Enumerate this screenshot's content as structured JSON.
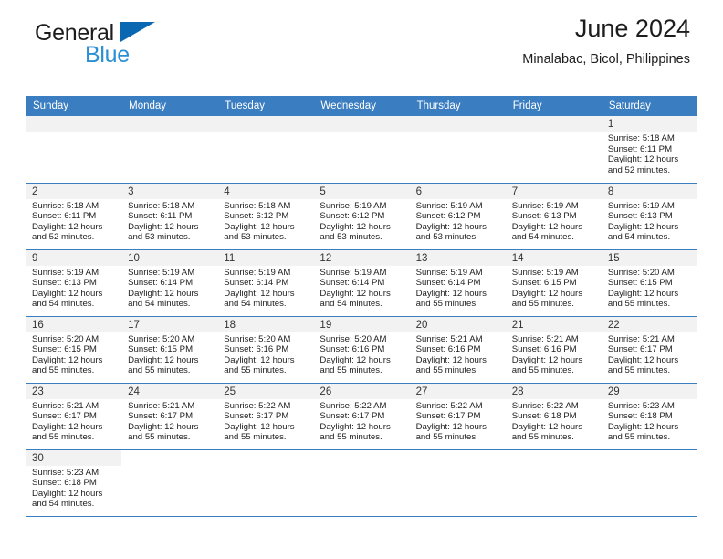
{
  "brand": {
    "name_part1": "General",
    "name_part2": "Blue",
    "flag_icon": "blue-triangle-flag"
  },
  "header": {
    "title": "June 2024",
    "location": "Minalabac, Bicol, Philippines"
  },
  "colors": {
    "header_blue": "#3a7dc0",
    "logo_dark": "#1d1d1d",
    "logo_blue": "#2a8fd4",
    "daynum_bg": "#f2f2f2"
  },
  "calendar": {
    "weekday_headers": [
      "Sunday",
      "Monday",
      "Tuesday",
      "Wednesday",
      "Thursday",
      "Friday",
      "Saturday"
    ],
    "labels": {
      "sunrise": "Sunrise:",
      "sunset": "Sunset:",
      "daylight": "Daylight:"
    },
    "weeks": [
      [
        {
          "empty": true
        },
        {
          "empty": true
        },
        {
          "empty": true
        },
        {
          "empty": true
        },
        {
          "empty": true
        },
        {
          "empty": true
        },
        {
          "day": "1",
          "sunrise": "Sunrise: 5:18 AM",
          "sunset": "Sunset: 6:11 PM",
          "daylight_line1": "Daylight: 12 hours",
          "daylight_line2": "and 52 minutes."
        }
      ],
      [
        {
          "day": "2",
          "sunrise": "Sunrise: 5:18 AM",
          "sunset": "Sunset: 6:11 PM",
          "daylight_line1": "Daylight: 12 hours",
          "daylight_line2": "and 52 minutes."
        },
        {
          "day": "3",
          "sunrise": "Sunrise: 5:18 AM",
          "sunset": "Sunset: 6:11 PM",
          "daylight_line1": "Daylight: 12 hours",
          "daylight_line2": "and 53 minutes."
        },
        {
          "day": "4",
          "sunrise": "Sunrise: 5:18 AM",
          "sunset": "Sunset: 6:12 PM",
          "daylight_line1": "Daylight: 12 hours",
          "daylight_line2": "and 53 minutes."
        },
        {
          "day": "5",
          "sunrise": "Sunrise: 5:19 AM",
          "sunset": "Sunset: 6:12 PM",
          "daylight_line1": "Daylight: 12 hours",
          "daylight_line2": "and 53 minutes."
        },
        {
          "day": "6",
          "sunrise": "Sunrise: 5:19 AM",
          "sunset": "Sunset: 6:12 PM",
          "daylight_line1": "Daylight: 12 hours",
          "daylight_line2": "and 53 minutes."
        },
        {
          "day": "7",
          "sunrise": "Sunrise: 5:19 AM",
          "sunset": "Sunset: 6:13 PM",
          "daylight_line1": "Daylight: 12 hours",
          "daylight_line2": "and 54 minutes."
        },
        {
          "day": "8",
          "sunrise": "Sunrise: 5:19 AM",
          "sunset": "Sunset: 6:13 PM",
          "daylight_line1": "Daylight: 12 hours",
          "daylight_line2": "and 54 minutes."
        }
      ],
      [
        {
          "day": "9",
          "sunrise": "Sunrise: 5:19 AM",
          "sunset": "Sunset: 6:13 PM",
          "daylight_line1": "Daylight: 12 hours",
          "daylight_line2": "and 54 minutes."
        },
        {
          "day": "10",
          "sunrise": "Sunrise: 5:19 AM",
          "sunset": "Sunset: 6:14 PM",
          "daylight_line1": "Daylight: 12 hours",
          "daylight_line2": "and 54 minutes."
        },
        {
          "day": "11",
          "sunrise": "Sunrise: 5:19 AM",
          "sunset": "Sunset: 6:14 PM",
          "daylight_line1": "Daylight: 12 hours",
          "daylight_line2": "and 54 minutes."
        },
        {
          "day": "12",
          "sunrise": "Sunrise: 5:19 AM",
          "sunset": "Sunset: 6:14 PM",
          "daylight_line1": "Daylight: 12 hours",
          "daylight_line2": "and 54 minutes."
        },
        {
          "day": "13",
          "sunrise": "Sunrise: 5:19 AM",
          "sunset": "Sunset: 6:14 PM",
          "daylight_line1": "Daylight: 12 hours",
          "daylight_line2": "and 55 minutes."
        },
        {
          "day": "14",
          "sunrise": "Sunrise: 5:19 AM",
          "sunset": "Sunset: 6:15 PM",
          "daylight_line1": "Daylight: 12 hours",
          "daylight_line2": "and 55 minutes."
        },
        {
          "day": "15",
          "sunrise": "Sunrise: 5:20 AM",
          "sunset": "Sunset: 6:15 PM",
          "daylight_line1": "Daylight: 12 hours",
          "daylight_line2": "and 55 minutes."
        }
      ],
      [
        {
          "day": "16",
          "sunrise": "Sunrise: 5:20 AM",
          "sunset": "Sunset: 6:15 PM",
          "daylight_line1": "Daylight: 12 hours",
          "daylight_line2": "and 55 minutes."
        },
        {
          "day": "17",
          "sunrise": "Sunrise: 5:20 AM",
          "sunset": "Sunset: 6:15 PM",
          "daylight_line1": "Daylight: 12 hours",
          "daylight_line2": "and 55 minutes."
        },
        {
          "day": "18",
          "sunrise": "Sunrise: 5:20 AM",
          "sunset": "Sunset: 6:16 PM",
          "daylight_line1": "Daylight: 12 hours",
          "daylight_line2": "and 55 minutes."
        },
        {
          "day": "19",
          "sunrise": "Sunrise: 5:20 AM",
          "sunset": "Sunset: 6:16 PM",
          "daylight_line1": "Daylight: 12 hours",
          "daylight_line2": "and 55 minutes."
        },
        {
          "day": "20",
          "sunrise": "Sunrise: 5:21 AM",
          "sunset": "Sunset: 6:16 PM",
          "daylight_line1": "Daylight: 12 hours",
          "daylight_line2": "and 55 minutes."
        },
        {
          "day": "21",
          "sunrise": "Sunrise: 5:21 AM",
          "sunset": "Sunset: 6:16 PM",
          "daylight_line1": "Daylight: 12 hours",
          "daylight_line2": "and 55 minutes."
        },
        {
          "day": "22",
          "sunrise": "Sunrise: 5:21 AM",
          "sunset": "Sunset: 6:17 PM",
          "daylight_line1": "Daylight: 12 hours",
          "daylight_line2": "and 55 minutes."
        }
      ],
      [
        {
          "day": "23",
          "sunrise": "Sunrise: 5:21 AM",
          "sunset": "Sunset: 6:17 PM",
          "daylight_line1": "Daylight: 12 hours",
          "daylight_line2": "and 55 minutes."
        },
        {
          "day": "24",
          "sunrise": "Sunrise: 5:21 AM",
          "sunset": "Sunset: 6:17 PM",
          "daylight_line1": "Daylight: 12 hours",
          "daylight_line2": "and 55 minutes."
        },
        {
          "day": "25",
          "sunrise": "Sunrise: 5:22 AM",
          "sunset": "Sunset: 6:17 PM",
          "daylight_line1": "Daylight: 12 hours",
          "daylight_line2": "and 55 minutes."
        },
        {
          "day": "26",
          "sunrise": "Sunrise: 5:22 AM",
          "sunset": "Sunset: 6:17 PM",
          "daylight_line1": "Daylight: 12 hours",
          "daylight_line2": "and 55 minutes."
        },
        {
          "day": "27",
          "sunrise": "Sunrise: 5:22 AM",
          "sunset": "Sunset: 6:17 PM",
          "daylight_line1": "Daylight: 12 hours",
          "daylight_line2": "and 55 minutes."
        },
        {
          "day": "28",
          "sunrise": "Sunrise: 5:22 AM",
          "sunset": "Sunset: 6:18 PM",
          "daylight_line1": "Daylight: 12 hours",
          "daylight_line2": "and 55 minutes."
        },
        {
          "day": "29",
          "sunrise": "Sunrise: 5:23 AM",
          "sunset": "Sunset: 6:18 PM",
          "daylight_line1": "Daylight: 12 hours",
          "daylight_line2": "and 55 minutes."
        }
      ],
      [
        {
          "day": "30",
          "sunrise": "Sunrise: 5:23 AM",
          "sunset": "Sunset: 6:18 PM",
          "daylight_line1": "Daylight: 12 hours",
          "daylight_line2": "and 54 minutes."
        },
        {
          "blank": true
        },
        {
          "blank": true
        },
        {
          "blank": true
        },
        {
          "blank": true
        },
        {
          "blank": true
        },
        {
          "blank": true
        }
      ]
    ]
  }
}
